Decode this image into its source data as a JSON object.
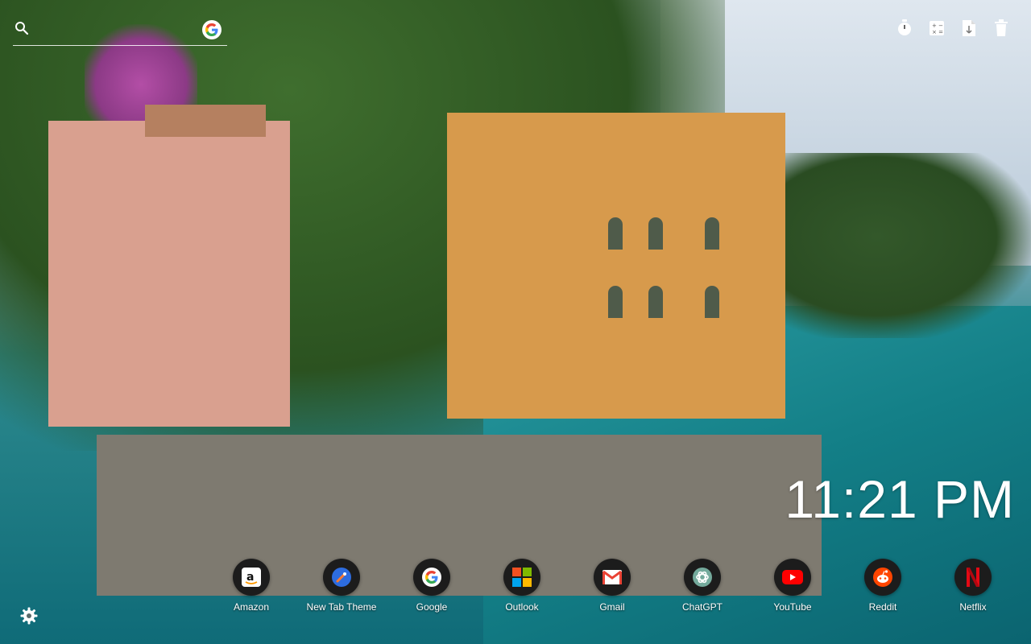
{
  "search": {
    "placeholder": "",
    "value": ""
  },
  "clock": {
    "time": "11:21 PM"
  },
  "topbar": {
    "icons": [
      "stopwatch-icon",
      "calculator-icon",
      "document-icon",
      "trash-icon"
    ]
  },
  "shortcuts": [
    {
      "label": "Amazon",
      "icon": "amazon-icon"
    },
    {
      "label": "New Tab Theme",
      "icon": "new-tab-theme-icon"
    },
    {
      "label": "Google",
      "icon": "google-icon"
    },
    {
      "label": "Outlook",
      "icon": "outlook-icon"
    },
    {
      "label": "Gmail",
      "icon": "gmail-icon"
    },
    {
      "label": "ChatGPT",
      "icon": "chatgpt-icon"
    },
    {
      "label": "YouTube",
      "icon": "youtube-icon"
    },
    {
      "label": "Reddit",
      "icon": "reddit-icon"
    },
    {
      "label": "Netflix",
      "icon": "netflix-icon"
    }
  ],
  "colors": {
    "dock_circle": "#1c1c1c",
    "youtube_red": "#ff0000",
    "netflix_red": "#e50914",
    "reddit_orange": "#ff4500",
    "google_blue": "#4285f4",
    "google_red": "#ea4335",
    "google_yellow": "#fbbc05",
    "google_green": "#34a853"
  }
}
